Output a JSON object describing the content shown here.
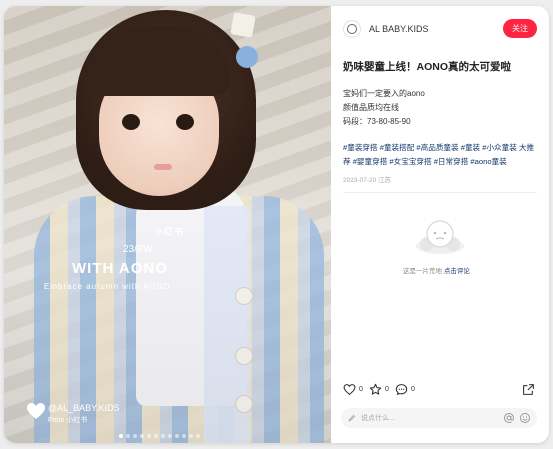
{
  "media": {
    "brand_overlay": "小红书",
    "season": "23/FW",
    "headline": "WITH AONO",
    "subline": "Embrace autumn with AONO",
    "watermark_user": "@AL_BABY.KIDS",
    "watermark_from": "From 小红书",
    "page_dots": 12,
    "active_dot": 1
  },
  "author": {
    "name": "AL BABY.KIDS",
    "follow_label": "关注"
  },
  "post": {
    "title": "奶味婴童上线！AONO真的太可爱啦",
    "lines": [
      "宝妈们一定要入的aono",
      "颜值品质均在线",
      "码段：73-80-85-90"
    ],
    "tags": "#童装穿搭 #童装搭配 #高品质童装 #童装 #小众童装 大推荐 #婴童穿搭 #女宝宝穿搭 #日常穿搭 #aono童装",
    "date": "2023-07-20 江苏"
  },
  "comments": {
    "empty_text": "这是一片荒地",
    "empty_link": "点击评论"
  },
  "actions": {
    "like_count": "0",
    "collect_count": "0",
    "comment_count": "0"
  },
  "comment_input": {
    "placeholder": "说点什么..."
  },
  "colors": {
    "accent": "#ff2442",
    "tag": "#13386c"
  }
}
